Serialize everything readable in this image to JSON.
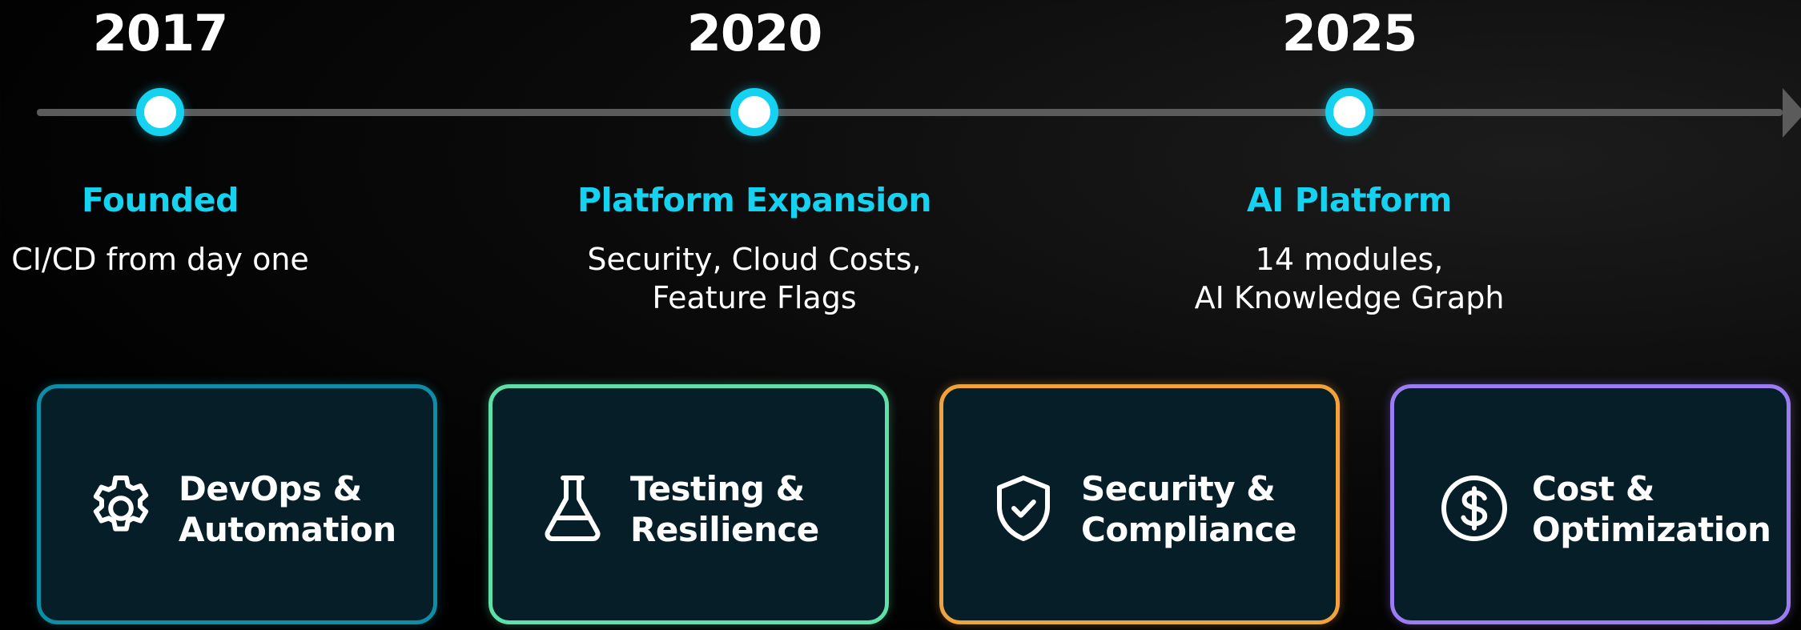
{
  "timeline": {
    "line_color": "#5b5b5b",
    "dot_color": "#14d2f0",
    "milestones": [
      {
        "year": "2017",
        "title": "Founded",
        "description": "CI/CD from day one"
      },
      {
        "year": "2020",
        "title": "Platform Expansion",
        "description": "Security, Cloud Costs,\nFeature Flags"
      },
      {
        "year": "2025",
        "title": "AI Platform",
        "description": "14 modules,\nAI Knowledge Graph"
      }
    ]
  },
  "cards": [
    {
      "label": "DevOps &\nAutomation",
      "icon": "gear-icon",
      "border_color": "#0e8ea6"
    },
    {
      "label": "Testing &\nResilience",
      "icon": "flask-icon",
      "border_color": "#5fe0a8"
    },
    {
      "label": "Security &\nCompliance",
      "icon": "shield-check-icon",
      "border_color": "#f0a23c"
    },
    {
      "label": "Cost &\nOptimization",
      "icon": "dollar-circle-icon",
      "border_color": "#9b7cf2"
    }
  ]
}
